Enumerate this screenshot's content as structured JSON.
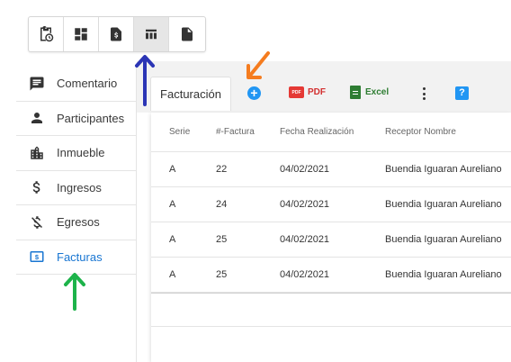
{
  "toolbar": {
    "buttons": [
      {
        "icon": "clipboard-clock-icon"
      },
      {
        "icon": "dashboard-icon"
      },
      {
        "icon": "invoice-dollar-icon"
      },
      {
        "icon": "table-icon",
        "active": true
      },
      {
        "icon": "document-icon"
      }
    ]
  },
  "sidebar": {
    "items": [
      {
        "label": "Comentario",
        "icon": "comment-icon"
      },
      {
        "label": "Participantes",
        "icon": "person-icon"
      },
      {
        "label": "Inmueble",
        "icon": "building-icon"
      },
      {
        "label": "Ingresos",
        "icon": "dollar-icon"
      },
      {
        "label": "Egresos",
        "icon": "money-off-icon"
      },
      {
        "label": "Facturas",
        "icon": "receipt-icon",
        "active": true
      }
    ]
  },
  "tab": {
    "label": "Facturación"
  },
  "actions": {
    "add": "+",
    "pdf_label": "PDF",
    "pdf_icon_text": "PDF",
    "excel_label": "Excel",
    "help": "?"
  },
  "table": {
    "headers": [
      "Serie",
      "#-Factura",
      "Fecha Realización",
      "Receptor Nombre"
    ],
    "rows": [
      [
        "A",
        "22",
        "04/02/2021",
        "Buendia Iguaran Aureliano"
      ],
      [
        "A",
        "24",
        "04/02/2021",
        "Buendia Iguaran Aureliano"
      ],
      [
        "A",
        "25",
        "04/02/2021",
        "Buendia Iguaran Aureliano"
      ],
      [
        "A",
        "25",
        "04/02/2021",
        "Buendia Iguaran Aureliano"
      ]
    ]
  },
  "colors": {
    "accent": "#1976d2",
    "arrow_blue": "#2b35b5",
    "arrow_orange": "#f57c1f",
    "arrow_green": "#1db34a"
  }
}
